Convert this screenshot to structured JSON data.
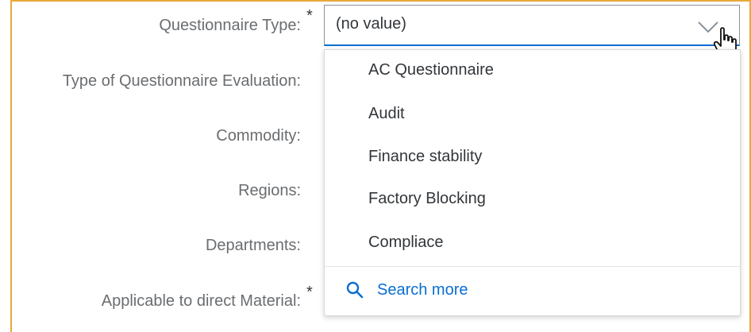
{
  "form": {
    "fields": [
      {
        "label": "Questionnaire Type:",
        "required": true
      },
      {
        "label": "Type of Questionnaire Evaluation:",
        "required": false
      },
      {
        "label": "Commodity:",
        "required": false
      },
      {
        "label": "Regions:",
        "required": false
      },
      {
        "label": "Departments:",
        "required": false
      },
      {
        "label": "Applicable to direct Material:",
        "required": true
      }
    ],
    "required_marker": "*"
  },
  "select": {
    "value": "(no value)",
    "icon": "chevron-down-icon",
    "accent_color": "#0a6ed1"
  },
  "dropdown": {
    "options": [
      "AC Questionnaire",
      "Audit",
      "Finance stability",
      "Factory Blocking",
      "Compliace"
    ],
    "search_more": "Search more",
    "search_icon": "search-icon"
  },
  "colors": {
    "frame_border": "#e9a93a",
    "label": "#6a6d70",
    "text": "#32363a",
    "link": "#0a6ed1"
  }
}
